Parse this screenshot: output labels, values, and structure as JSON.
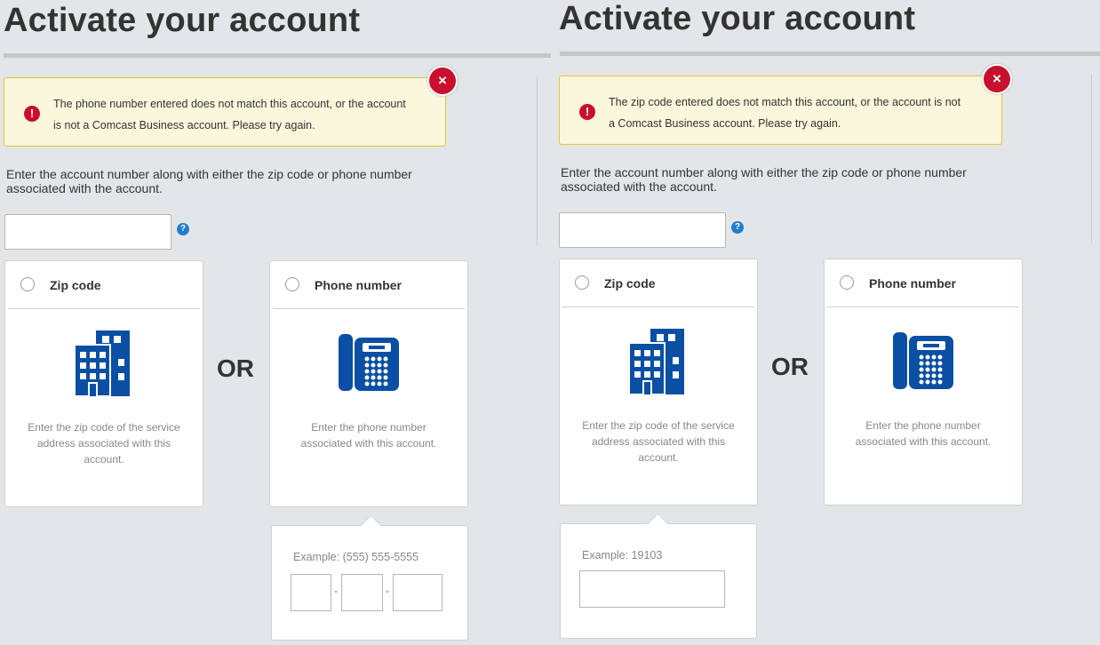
{
  "page_title": "Activate your account",
  "colors": {
    "alert_bg": "#fbf7dc",
    "alert_border": "#e6c23a",
    "error_red": "#c8102e",
    "icon_blue": "#0a4fa3",
    "help_blue": "#1f7dcd"
  },
  "left_panel": {
    "title": "Activate your account",
    "alert": {
      "icon": "error-icon",
      "message": "The phone number entered does not match this account, or the account is not a Comcast Business account. Please try again.",
      "close": "×"
    },
    "instructions": "Enter the account number along with either the zip code or phone number associated with the account.",
    "account_input": {
      "value": "",
      "placeholder": ""
    },
    "help": "?",
    "options": [
      {
        "label": "Zip code",
        "icon": "building-icon",
        "description": "Enter the zip code of the service address associated with this account."
      },
      {
        "label": "Phone number",
        "icon": "phone-icon",
        "description": "Enter the phone number associated with this account."
      }
    ],
    "or": "OR",
    "popup": {
      "example": "Example: (555) 555-5555",
      "separator": "-"
    }
  },
  "right_panel": {
    "title": "Activate your account",
    "alert": {
      "icon": "error-icon",
      "message": "The zip code entered does not match this account, or the account is not a Comcast Business account. Please try again.",
      "close": "×"
    },
    "instructions": "Enter the account number along with either the zip code or phone number associated with the account.",
    "account_input": {
      "value": "",
      "placeholder": ""
    },
    "help": "?",
    "options": [
      {
        "label": "Zip code",
        "icon": "building-icon",
        "description": "Enter the zip code of the service address associated with this account."
      },
      {
        "label": "Phone number",
        "icon": "phone-icon",
        "description": "Enter the phone number associated with this account."
      }
    ],
    "or": "OR",
    "popup": {
      "example": "Example: 19103"
    }
  }
}
